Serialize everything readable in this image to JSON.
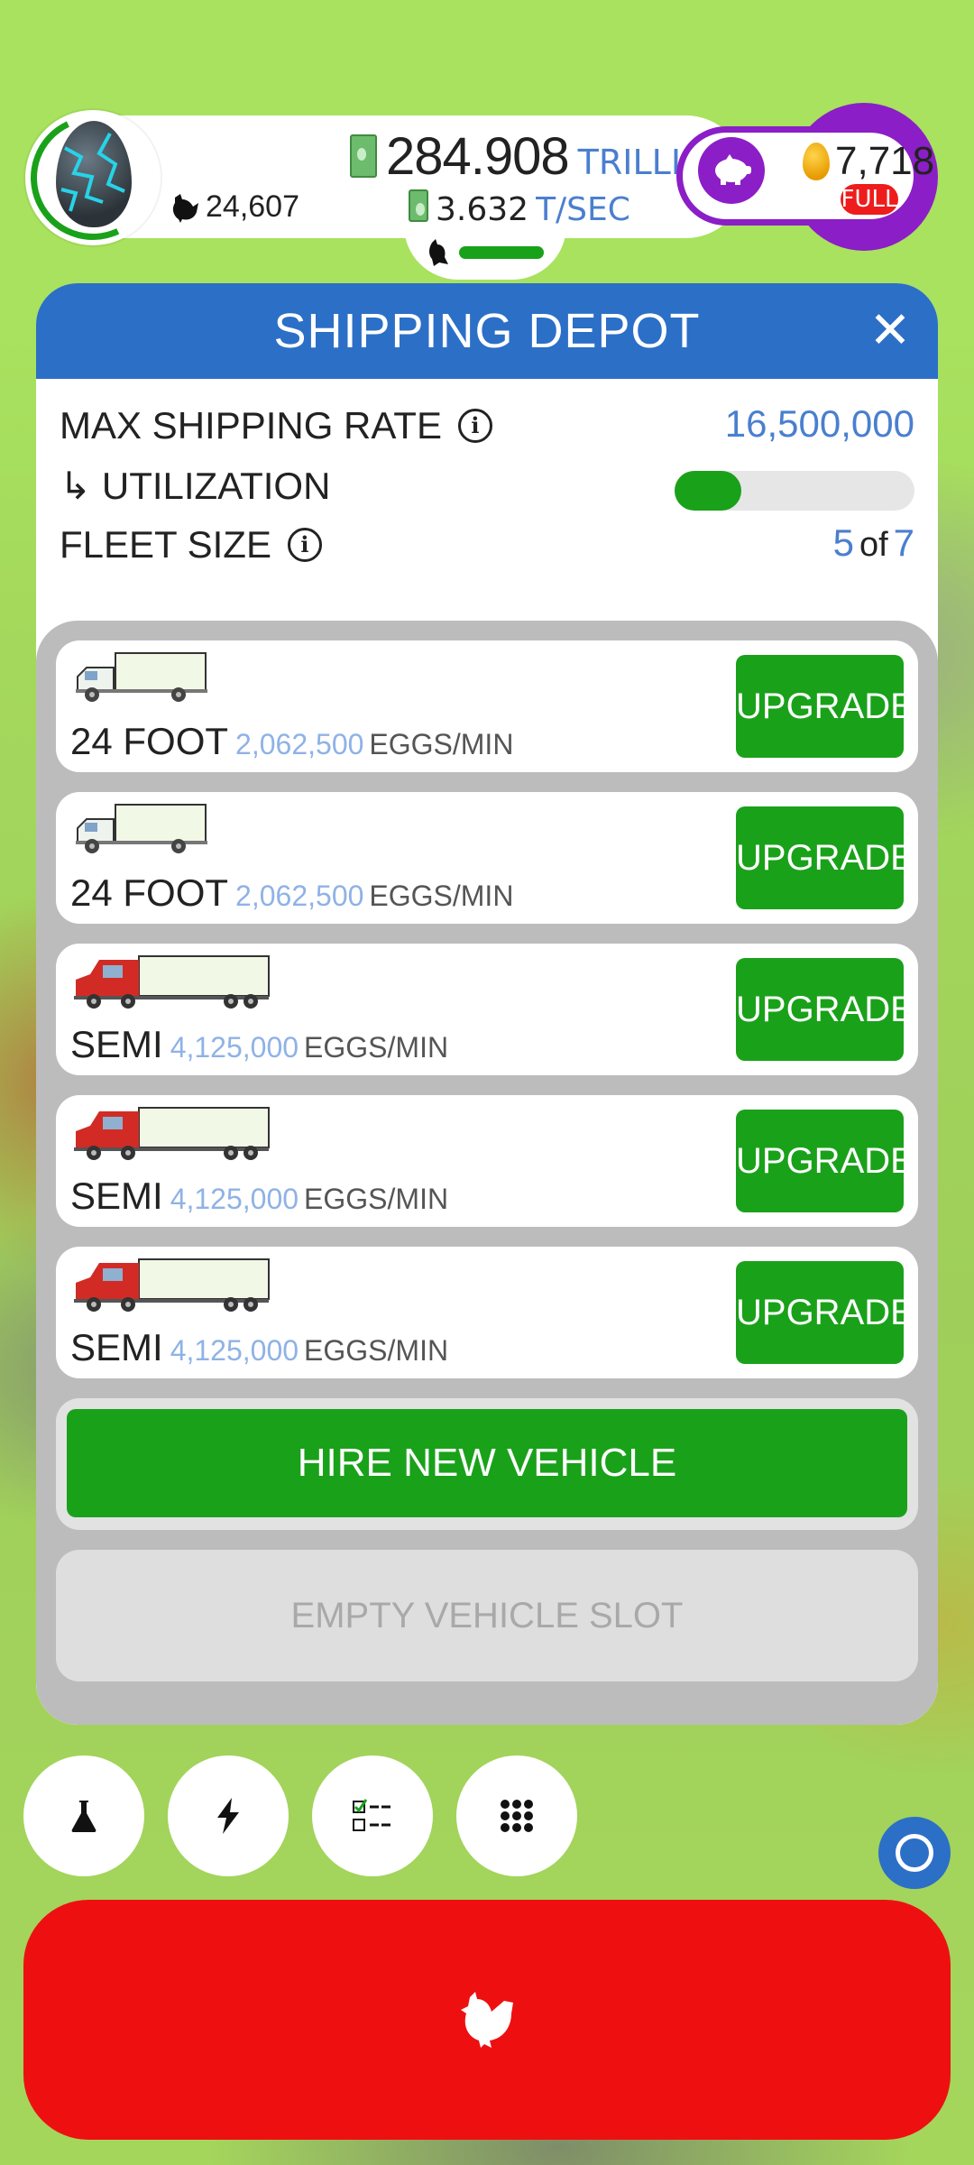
{
  "topbar": {
    "chicken_count": "24,607",
    "money_value": "284.908",
    "money_unit": "TRILLION",
    "rate_value": "3.632",
    "rate_unit": "T/SEC",
    "golden_eggs": "7,718",
    "piggy_status": "FULL"
  },
  "dialog": {
    "title": "SHIPPING DEPOT",
    "close_symbol": "✕",
    "max_rate_label": "MAX SHIPPING RATE",
    "max_rate_value": "16,500,000",
    "utilization_label": "↳ UTILIZATION",
    "utilization_fraction": 0.28,
    "fleet_label": "FLEET SIZE",
    "fleet_current": "5",
    "fleet_of": "of",
    "fleet_max": "7",
    "info_icon": "i"
  },
  "vehicles": [
    {
      "name": "24 FOOT",
      "rate": "2,062,500",
      "unit": "EGGS/MIN",
      "button": "UPGRADE",
      "icon": "box-truck-icon"
    },
    {
      "name": "24 FOOT",
      "rate": "2,062,500",
      "unit": "EGGS/MIN",
      "button": "UPGRADE",
      "icon": "box-truck-icon"
    },
    {
      "name": "SEMI",
      "rate": "4,125,000",
      "unit": "EGGS/MIN",
      "button": "UPGRADE",
      "icon": "semi-truck-icon"
    },
    {
      "name": "SEMI",
      "rate": "4,125,000",
      "unit": "EGGS/MIN",
      "button": "UPGRADE",
      "icon": "semi-truck-icon"
    },
    {
      "name": "SEMI",
      "rate": "4,125,000",
      "unit": "EGGS/MIN",
      "button": "UPGRADE",
      "icon": "semi-truck-icon"
    }
  ],
  "hire_button": "HIRE NEW VEHICLE",
  "empty_slot": "EMPTY VEHICLE SLOT",
  "bottom_buttons": [
    {
      "icon": "flask-icon",
      "glyph": "⚗"
    },
    {
      "icon": "lightning-icon",
      "glyph": "⚡"
    },
    {
      "icon": "checklist-icon",
      "glyph": ""
    },
    {
      "icon": "grid-menu-icon",
      "glyph": ""
    }
  ],
  "colors": {
    "accent_blue": "#2c6fc7",
    "button_green": "#1aa11a",
    "hatch_red": "#ee1010",
    "piggy_purple": "#8b1ec7"
  }
}
